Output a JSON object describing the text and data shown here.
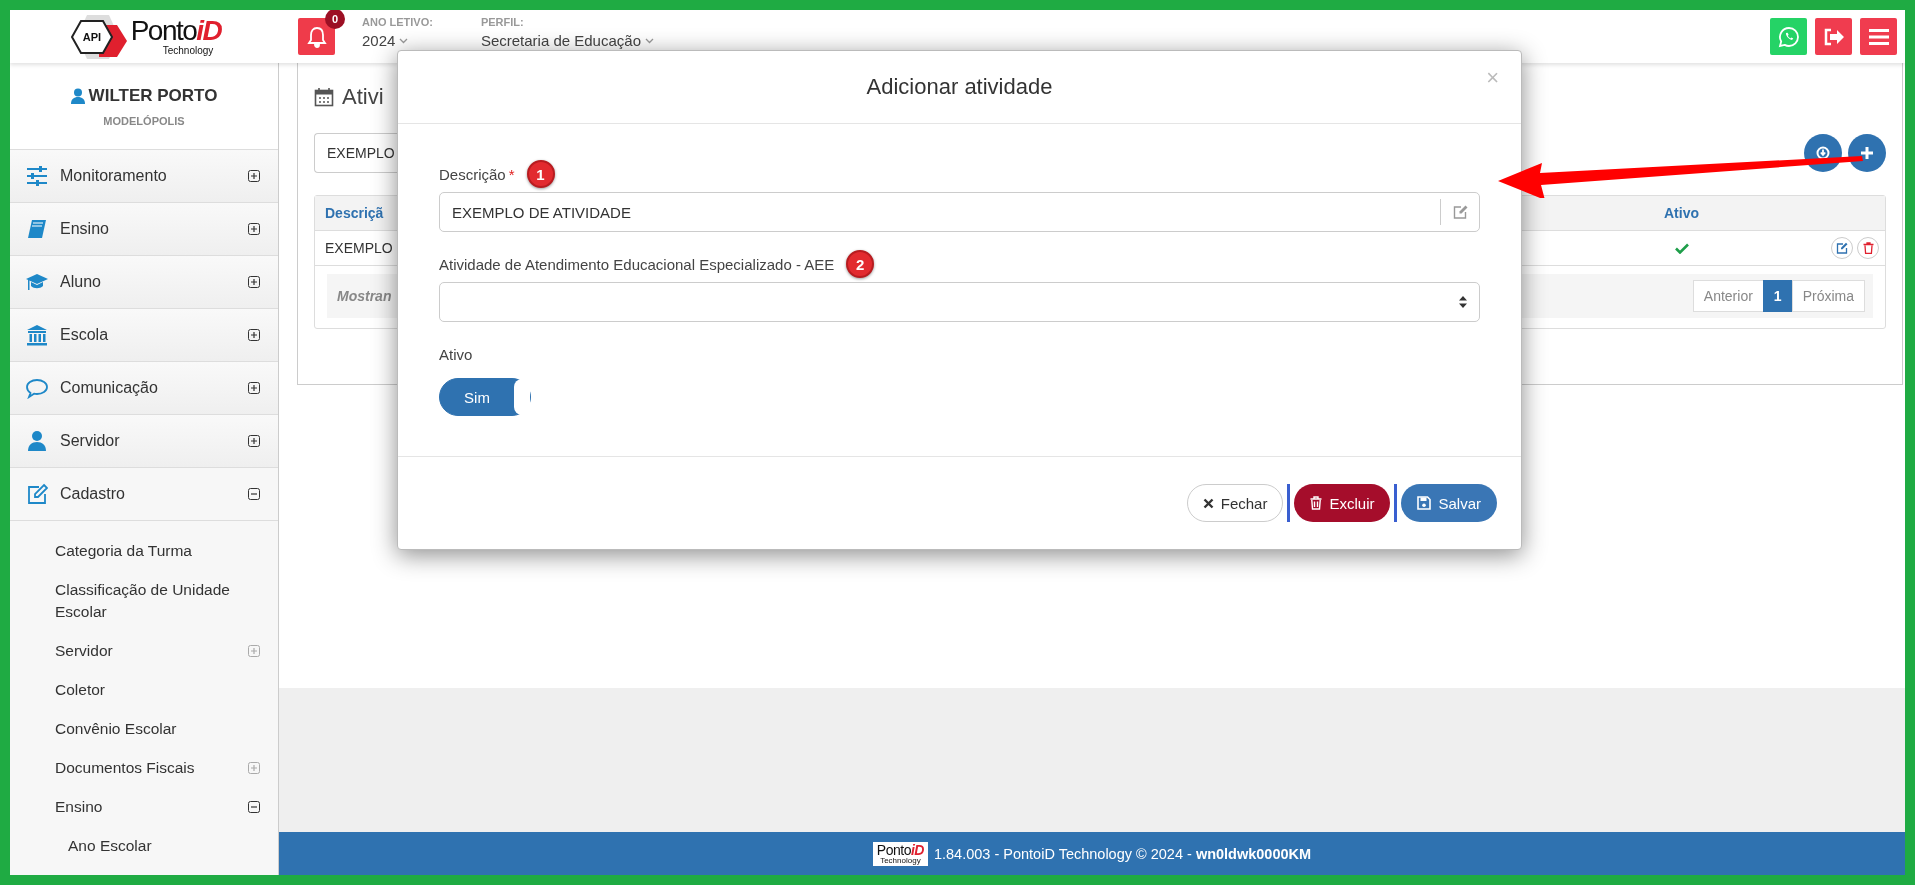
{
  "header": {
    "logo": {
      "badge": "API",
      "word": "Ponto",
      "accent": "iD",
      "tagline": "Technology"
    },
    "notifications": {
      "count": "0"
    },
    "year": {
      "label": "ANO LETIVO:",
      "value": "2024"
    },
    "profile": {
      "label": "PERFIL:",
      "value": "Secretaria de Educação"
    }
  },
  "sidebar": {
    "user": {
      "name": "WILTER PORTO",
      "city": "MODELÓPOLIS"
    },
    "items": [
      {
        "label": "Monitoramento",
        "expanded": false
      },
      {
        "label": "Ensino",
        "expanded": false
      },
      {
        "label": "Aluno",
        "expanded": false
      },
      {
        "label": "Escola",
        "expanded": false
      },
      {
        "label": "Comunicação",
        "expanded": false
      },
      {
        "label": "Servidor",
        "expanded": false
      },
      {
        "label": "Cadastro",
        "expanded": true,
        "children": [
          {
            "label": "Categoria da Turma",
            "kind": "link"
          },
          {
            "label": "Classificação de Unidade Escolar",
            "kind": "link"
          },
          {
            "label": "Servidor",
            "kind": "group",
            "expanded": false
          },
          {
            "label": "Coletor",
            "kind": "link"
          },
          {
            "label": "Convênio Escolar",
            "kind": "link"
          },
          {
            "label": "Documentos Fiscais",
            "kind": "group",
            "expanded": false
          },
          {
            "label": "Ensino",
            "kind": "group",
            "expanded": true,
            "children": [
              {
                "label": "Ano Escolar",
                "kind": "link"
              }
            ]
          }
        ]
      }
    ]
  },
  "page": {
    "title": "Ativi",
    "search": {
      "value": "EXEMPLO"
    },
    "table": {
      "columns": [
        "Descriçã",
        "Ativo"
      ],
      "rows": [
        {
          "description": "EXEMPLO",
          "active": true
        }
      ],
      "summary": "Mostran",
      "pagination": [
        {
          "label": "Anterior",
          "selected": false
        },
        {
          "label": "1",
          "selected": true
        },
        {
          "label": "Próxima",
          "selected": false
        }
      ]
    }
  },
  "modal": {
    "title": "Adicionar atividade",
    "close": "×",
    "fields": [
      {
        "label": "Descrição",
        "required_mark": "*",
        "kind": "text",
        "value": "EXEMPLO DE ATIVIDADE",
        "annotation": "1"
      },
      {
        "label": "Atividade de Atendimento Educacional Especializado - AEE",
        "kind": "select",
        "annotation": "2"
      }
    ],
    "toggle": {
      "label": "Ativo",
      "text": "Sim",
      "on": true
    },
    "buttons": [
      {
        "label": "Fechar",
        "kind": "default"
      },
      {
        "label": "Excluir",
        "kind": "danger"
      },
      {
        "label": "Salvar",
        "kind": "primary"
      }
    ]
  },
  "footer": {
    "logo": {
      "word": "Ponto",
      "accent": "iD",
      "tagline": "Technology"
    },
    "text": "1.84.003 - PontoiD Technology © 2024 - **wn0ldwk0000KM**"
  }
}
